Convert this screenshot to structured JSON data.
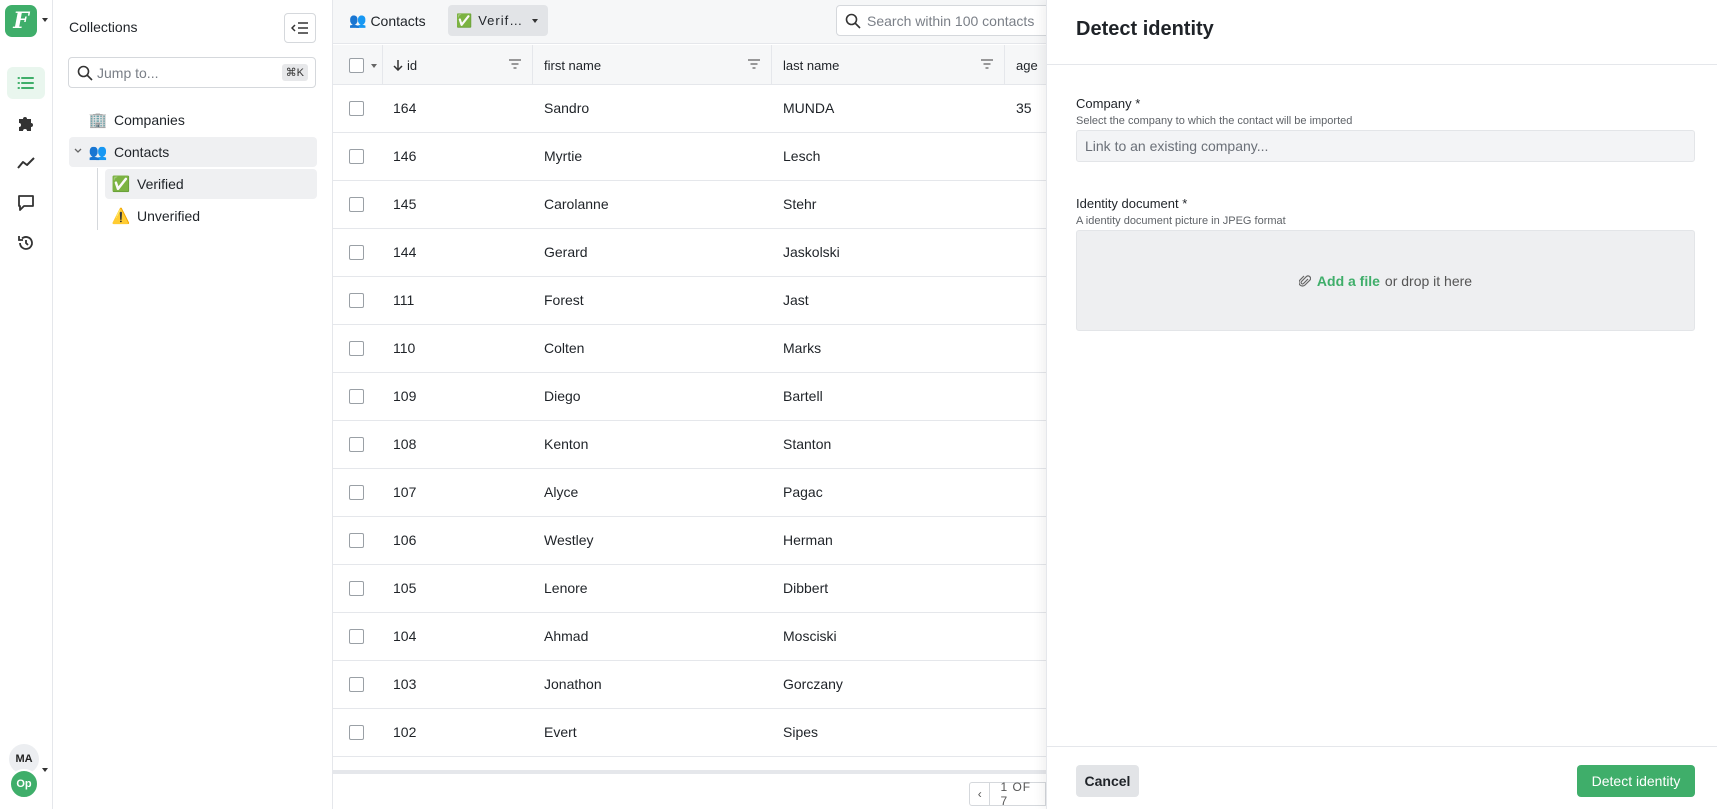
{
  "rail": {
    "logo_letter": "F",
    "avatar_user": "MA",
    "avatar_org": "Op"
  },
  "collections": {
    "title": "Collections",
    "jump_placeholder": "Jump to...",
    "jump_shortcut": "⌘K",
    "items": [
      {
        "emoji": "🏢",
        "label": "Companies"
      },
      {
        "emoji": "👥",
        "label": "Contacts"
      },
      {
        "emoji": "✅",
        "label": "Verified"
      },
      {
        "emoji": "⚠️",
        "label": "Unverified"
      }
    ]
  },
  "main": {
    "breadcrumb_emoji": "👥",
    "breadcrumb": "Contacts",
    "view_emoji": "✅",
    "view_label": "Verif…",
    "search_placeholder": "Search within 100 contacts",
    "columns": {
      "id": "id",
      "first": "first name",
      "last": "last name",
      "age": "age"
    },
    "rows": [
      {
        "id": "164",
        "first": "Sandro",
        "last": "MUNDA",
        "age": "35"
      },
      {
        "id": "146",
        "first": "Myrtie",
        "last": "Lesch",
        "age": ""
      },
      {
        "id": "145",
        "first": "Carolanne",
        "last": "Stehr",
        "age": ""
      },
      {
        "id": "144",
        "first": "Gerard",
        "last": "Jaskolski",
        "age": ""
      },
      {
        "id": "111",
        "first": "Forest",
        "last": "Jast",
        "age": ""
      },
      {
        "id": "110",
        "first": "Colten",
        "last": "Marks",
        "age": ""
      },
      {
        "id": "109",
        "first": "Diego",
        "last": "Bartell",
        "age": ""
      },
      {
        "id": "108",
        "first": "Kenton",
        "last": "Stanton",
        "age": ""
      },
      {
        "id": "107",
        "first": "Alyce",
        "last": "Pagac",
        "age": ""
      },
      {
        "id": "106",
        "first": "Westley",
        "last": "Herman",
        "age": ""
      },
      {
        "id": "105",
        "first": "Lenore",
        "last": "Dibbert",
        "age": ""
      },
      {
        "id": "104",
        "first": "Ahmad",
        "last": "Mosciski",
        "age": ""
      },
      {
        "id": "103",
        "first": "Jonathon",
        "last": "Gorczany",
        "age": ""
      },
      {
        "id": "102",
        "first": "Evert",
        "last": "Sipes",
        "age": ""
      }
    ],
    "pager_prev": "‹",
    "pager_text": "1 OF 7"
  },
  "drawer": {
    "title": "Detect identity",
    "company_label": "Company *",
    "company_help": "Select the company to which the contact will be imported",
    "company_placeholder": "Link to an existing company...",
    "doc_label": "Identity document *",
    "doc_help": "A identity document picture in JPEG format",
    "dropzone_link": "Add a file",
    "dropzone_rest": "or drop it here",
    "cancel": "Cancel",
    "submit": "Detect identity"
  },
  "colors": {
    "accent": "#3fae6a"
  }
}
